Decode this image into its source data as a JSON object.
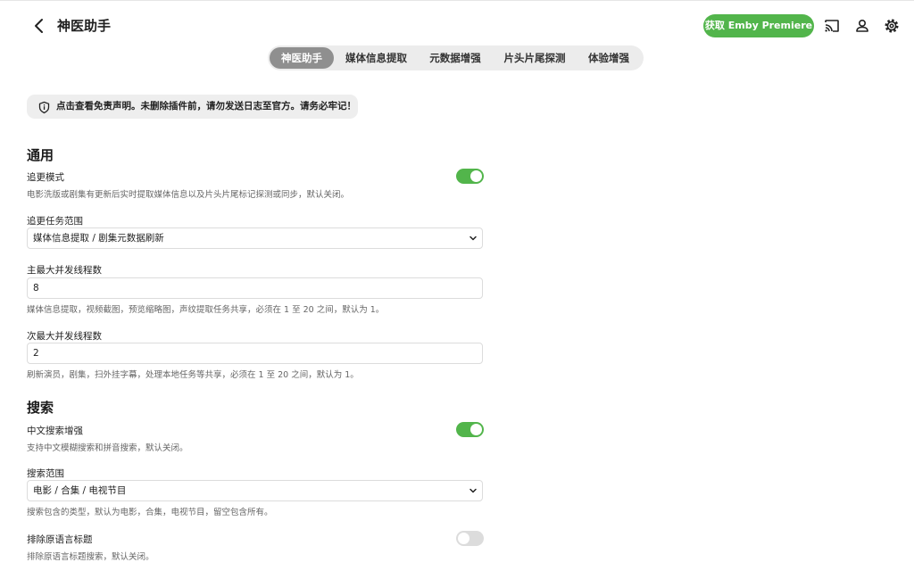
{
  "header": {
    "title": "神医助手",
    "premiere_label": "获取 Emby Premiere"
  },
  "tabs": [
    {
      "label": "神医助手",
      "active": true
    },
    {
      "label": "媒体信息提取",
      "active": false
    },
    {
      "label": "元数据增强",
      "active": false
    },
    {
      "label": "片头片尾探测",
      "active": false
    },
    {
      "label": "体验增强",
      "active": false
    }
  ],
  "notice": "点击查看免责声明。未删除插件前，请勿发送日志至官方。请务必牢记！",
  "general": {
    "heading": "通用",
    "follow_mode": {
      "label": "追更模式",
      "desc": "电影洗版或剧集有更新后实时提取媒体信息以及片头片尾标记探测或同步，默认关闭。",
      "enabled": true
    },
    "follow_scope": {
      "label": "追更任务范围",
      "value": "媒体信息提取 / 剧集元数据刷新"
    },
    "main_threads": {
      "label": "主最大并发线程数",
      "value": "8",
      "desc": "媒体信息提取，视频截图，预览缩略图，声纹提取任务共享，必须在 1 至 20 之间，默认为 1。"
    },
    "sub_threads": {
      "label": "次最大并发线程数",
      "value": "2",
      "desc": "刷新演员，剧集，扫外挂字幕，处理本地任务等共享，必须在 1 至 20 之间，默认为 1。"
    }
  },
  "search": {
    "heading": "搜索",
    "chinese_search": {
      "label": "中文搜索增强",
      "desc": "支持中文模糊搜索和拼音搜索，默认关闭。",
      "enabled": true
    },
    "scope": {
      "label": "搜索范围",
      "value": "电影 / 合集 / 电视节目",
      "desc": "搜索包含的类型，默认为电影，合集，电视节目，留空包含所有。"
    },
    "exclude_original": {
      "label": "排除原语言标题",
      "desc": "排除原语言标题搜索，默认关闭。",
      "enabled": false
    }
  },
  "colors": {
    "accent": "#52b54b",
    "tab_active": "#8f8f8f",
    "toggle_off": "#dcdcdc"
  },
  "icons": {
    "back": "chevron-left-icon",
    "cast": "cast-icon",
    "user": "user-icon",
    "settings": "gear-icon",
    "notice": "shield-info-icon",
    "dropdown": "chevron-down-icon"
  }
}
